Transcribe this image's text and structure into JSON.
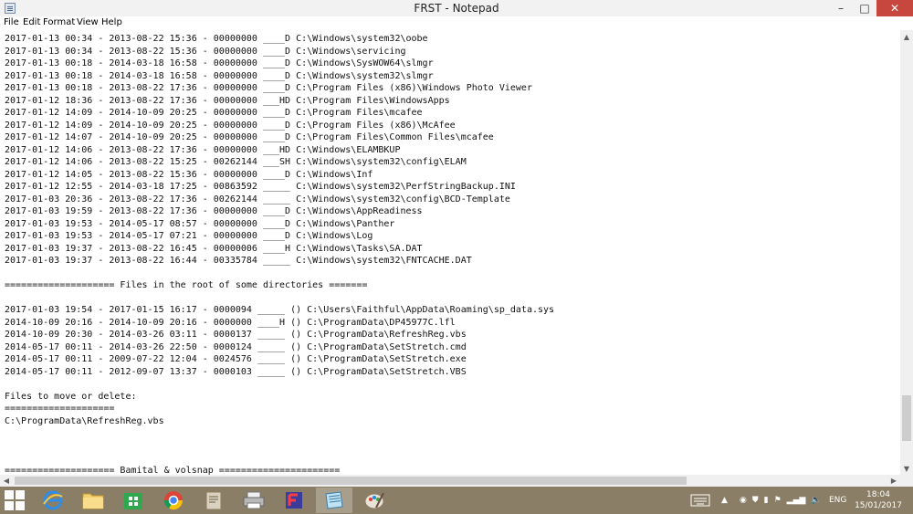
{
  "window": {
    "title": "FRST - Notepad",
    "controls": {
      "minimize": "–",
      "maximize": "□",
      "close": "✕"
    }
  },
  "menu": {
    "file": "File",
    "edit": "Edit",
    "format": "Format",
    "view": "View",
    "help": "Help"
  },
  "editor": {
    "lines": [
      "2017-01-13 00:34 - 2013-08-22 15:36 - 00000000 ____D C:\\Windows\\system32\\oobe",
      "2017-01-13 00:34 - 2013-08-22 15:36 - 00000000 ____D C:\\Windows\\servicing",
      "2017-01-13 00:18 - 2014-03-18 16:58 - 00000000 ____D C:\\Windows\\SysWOW64\\slmgr",
      "2017-01-13 00:18 - 2014-03-18 16:58 - 00000000 ____D C:\\Windows\\system32\\slmgr",
      "2017-01-13 00:18 - 2013-08-22 17:36 - 00000000 ____D C:\\Program Files (x86)\\Windows Photo Viewer",
      "2017-01-12 18:36 - 2013-08-22 17:36 - 00000000 ___HD C:\\Program Files\\WindowsApps",
      "2017-01-12 14:09 - 2014-10-09 20:25 - 00000000 ____D C:\\Program Files\\mcafee",
      "2017-01-12 14:09 - 2014-10-09 20:25 - 00000000 ____D C:\\Program Files (x86)\\McAfee",
      "2017-01-12 14:07 - 2014-10-09 20:25 - 00000000 ____D C:\\Program Files\\Common Files\\mcafee",
      "2017-01-12 14:06 - 2013-08-22 17:36 - 00000000 ___HD C:\\Windows\\ELAMBKUP",
      "2017-01-12 14:06 - 2013-08-22 15:25 - 00262144 ___SH C:\\Windows\\system32\\config\\ELAM",
      "2017-01-12 14:05 - 2013-08-22 15:36 - 00000000 ____D C:\\Windows\\Inf",
      "2017-01-12 12:55 - 2014-03-18 17:25 - 00863592 _____ C:\\Windows\\system32\\PerfStringBackup.INI",
      "2017-01-03 20:36 - 2013-08-22 17:36 - 00262144 _____ C:\\Windows\\system32\\config\\BCD-Template",
      "2017-01-03 19:59 - 2013-08-22 17:36 - 00000000 ____D C:\\Windows\\AppReadiness",
      "2017-01-03 19:53 - 2014-05-17 08:57 - 00000000 ____D C:\\Windows\\Panther",
      "2017-01-03 19:53 - 2014-05-17 07:21 - 00000000 ____D C:\\Windows\\Log",
      "2017-01-03 19:37 - 2013-08-22 16:45 - 00000006 ____H C:\\Windows\\Tasks\\SA.DAT",
      "2017-01-03 19:37 - 2013-08-22 16:44 - 00335784 _____ C:\\Windows\\system32\\FNTCACHE.DAT",
      "",
      "==================== Files in the root of some directories =======",
      "",
      "2017-01-03 19:54 - 2017-01-15 16:17 - 0000094 _____ () C:\\Users\\Faithful\\AppData\\Roaming\\sp_data.sys",
      "2014-10-09 20:16 - 2014-10-09 20:16 - 0000000 ____H () C:\\ProgramData\\DP45977C.lfl",
      "2014-10-09 20:30 - 2014-03-26 03:11 - 0000137 _____ () C:\\ProgramData\\RefreshReg.vbs",
      "2014-05-17 00:11 - 2014-03-26 22:50 - 0000124 _____ () C:\\ProgramData\\SetStretch.cmd",
      "2014-05-17 00:11 - 2009-07-22 12:04 - 0024576 _____ () C:\\ProgramData\\SetStretch.exe",
      "2014-05-17 00:11 - 2012-09-07 13:37 - 0000103 _____ () C:\\ProgramData\\SetStretch.VBS",
      "",
      "Files to move or delete:",
      "====================",
      "C:\\ProgramData\\RefreshReg.vbs",
      "",
      "",
      "",
      "==================== Bamital & volsnap ======================"
    ]
  },
  "tray": {
    "language": "ENG",
    "time": "18:04",
    "date": "15/01/2017"
  },
  "colors": {
    "taskbar": "#8a7f66",
    "close_button": "#c7463d",
    "start_logo": "#ffffff"
  }
}
